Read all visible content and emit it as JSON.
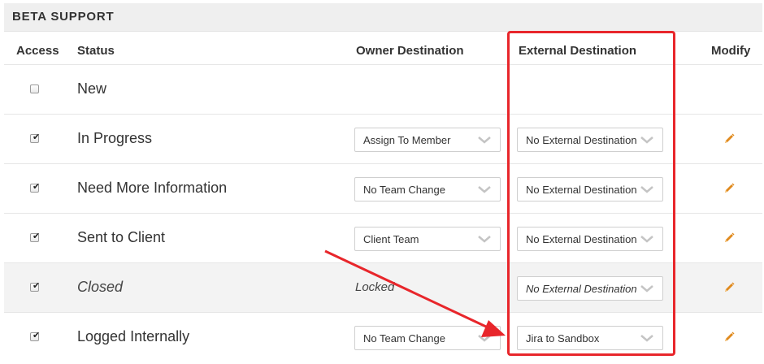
{
  "section": {
    "title": "BETA SUPPORT"
  },
  "columns": {
    "access": "Access",
    "status": "Status",
    "owner": "Owner Destination",
    "external": "External Destination",
    "modify": "Modify"
  },
  "rows": [
    {
      "checked": false,
      "status": "New"
    },
    {
      "checked": true,
      "status": "In Progress",
      "owner": "Assign To Member",
      "external": "No External Destination"
    },
    {
      "checked": true,
      "status": "Need More Information",
      "owner": "No Team Change",
      "external": "No External Destination"
    },
    {
      "checked": true,
      "status": "Sent to Client",
      "owner": "Client Team",
      "external": "No External Destination"
    },
    {
      "checked": true,
      "status": "Closed",
      "owner_locked": "Locked",
      "external": "No External Destination"
    },
    {
      "checked": true,
      "status": "Logged Internally",
      "owner": "No Team Change",
      "external": "Jira to Sandbox"
    }
  ],
  "colors": {
    "highlight": "#e8262b",
    "pencil": "#e08a1e"
  },
  "icons": {
    "checkbox_mark": "✔",
    "modify": "pencil-icon",
    "dropdown": "chevron-down-icon"
  }
}
